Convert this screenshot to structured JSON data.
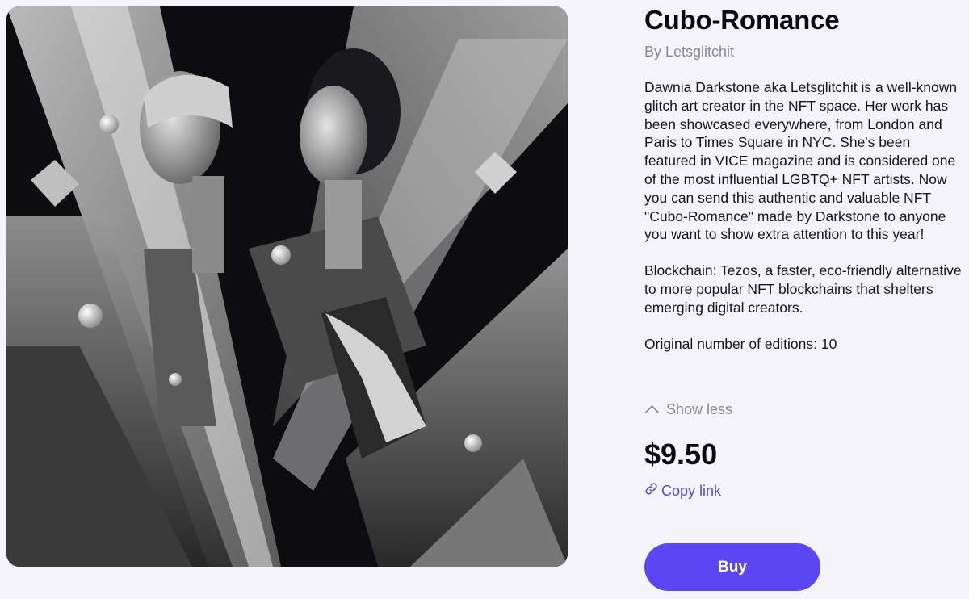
{
  "artwork": {
    "alt": "Cubist-style black and white artwork of two figures kissing"
  },
  "product": {
    "title": "Cubo-Romance",
    "author": "By Letsglitchit",
    "description": [
      "Dawnia Darkstone aka Letsglitchit is a well-known glitch art creator in the NFT space. Her work has been showcased everywhere, from London and Paris to Times Square in NYC. She's been featured in VICE magazine and is considered one of the most influential LGBTQ+ NFT artists. Now you can send this authentic and valuable NFT \"Cubo-Romance\" made by Darkstone to anyone you want to show extra attention to this year!",
      "Blockchain: Tezos, a faster, eco-friendly alternative to more popular NFT blockchains that shelters emerging digital creators.",
      "Original number of editions: 10"
    ],
    "price": "$9.50"
  },
  "actions": {
    "show_less_label": "Show less",
    "show_less_icon": "chevron-up-icon",
    "copy_link_label": "Copy link",
    "copy_link_icon": "link-icon",
    "buy_label": "Buy"
  },
  "colors": {
    "background": "#f4f4fa",
    "accent": "#5b46f4",
    "link": "#5a4bd6",
    "muted": "#8a8a94"
  }
}
